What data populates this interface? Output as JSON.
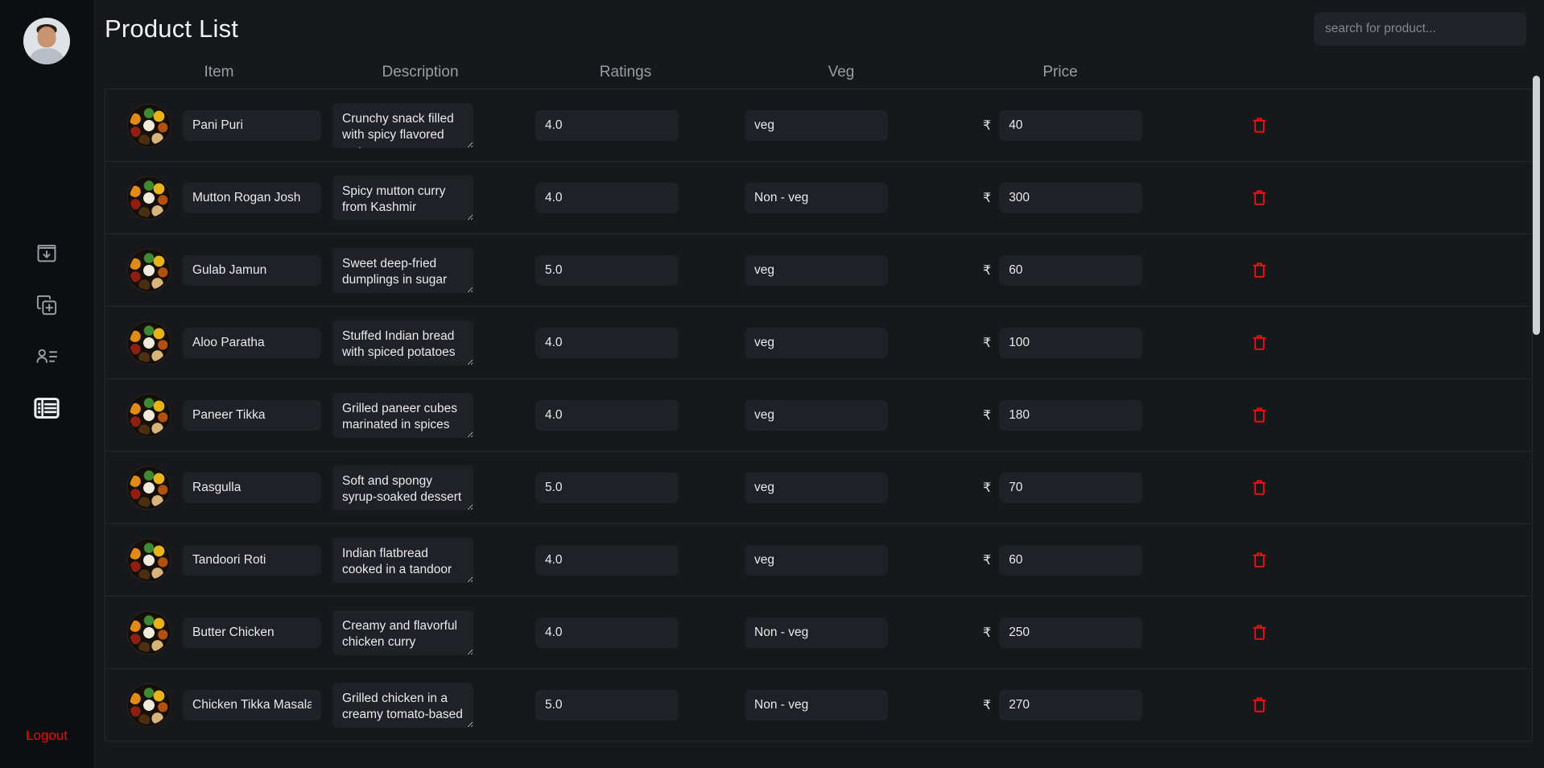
{
  "sidebar": {
    "avatar_alt": "user avatar",
    "nav": [
      {
        "icon": "archive-download-icon",
        "name": "sidebar-item-import"
      },
      {
        "icon": "copy-plus-icon",
        "name": "sidebar-item-add-product"
      },
      {
        "icon": "contact-list-icon",
        "name": "sidebar-item-customers"
      },
      {
        "icon": "list-view-icon",
        "name": "sidebar-item-product-list",
        "active": true
      }
    ],
    "logout_label": "Logout"
  },
  "header": {
    "title": "Product List"
  },
  "search": {
    "placeholder": "search for product...",
    "value": ""
  },
  "table": {
    "columns": [
      "Item",
      "Description",
      "Ratings",
      "Veg",
      "Price"
    ],
    "currency_symbol": "₹",
    "delete_icon": "trash-icon",
    "delete_color": "#ee1111",
    "rows": [
      {
        "name": "Pani Puri",
        "description": "Crunchy snack filled with spicy flavored water",
        "rating": "4.0",
        "veg": "veg",
        "price": "40"
      },
      {
        "name": "Mutton Rogan Josh",
        "description": "Spicy mutton curry from Kashmir",
        "rating": "4.0",
        "veg": "Non - veg",
        "price": "300"
      },
      {
        "name": "Gulab Jamun",
        "description": "Sweet deep-fried dumplings in sugar syrup",
        "rating": "5.0",
        "veg": "veg",
        "price": "60"
      },
      {
        "name": "Aloo Paratha",
        "description": "Stuffed Indian bread with spiced potatoes",
        "rating": "4.0",
        "veg": "veg",
        "price": "100"
      },
      {
        "name": "Paneer Tikka",
        "description": "Grilled paneer cubes marinated in spices",
        "rating": "4.0",
        "veg": "veg",
        "price": "180"
      },
      {
        "name": "Rasgulla",
        "description": "Soft and spongy syrup-soaked dessert",
        "rating": "5.0",
        "veg": "veg",
        "price": "70"
      },
      {
        "name": "Tandoori Roti",
        "description": "Indian flatbread cooked in a tandoor",
        "rating": "4.0",
        "veg": "veg",
        "price": "60"
      },
      {
        "name": "Butter Chicken",
        "description": "Creamy and flavorful chicken curry",
        "rating": "4.0",
        "veg": "Non - veg",
        "price": "250"
      },
      {
        "name": "Chicken Tikka Masala",
        "description": "Grilled chicken in a creamy tomato-based sauce",
        "rating": "5.0",
        "veg": "Non - veg",
        "price": "270"
      }
    ]
  },
  "theme": {
    "background": "#17181c",
    "sidebar_background": "#0d0e12",
    "field_background": "#202127",
    "accent_danger": "#f10a0a"
  }
}
